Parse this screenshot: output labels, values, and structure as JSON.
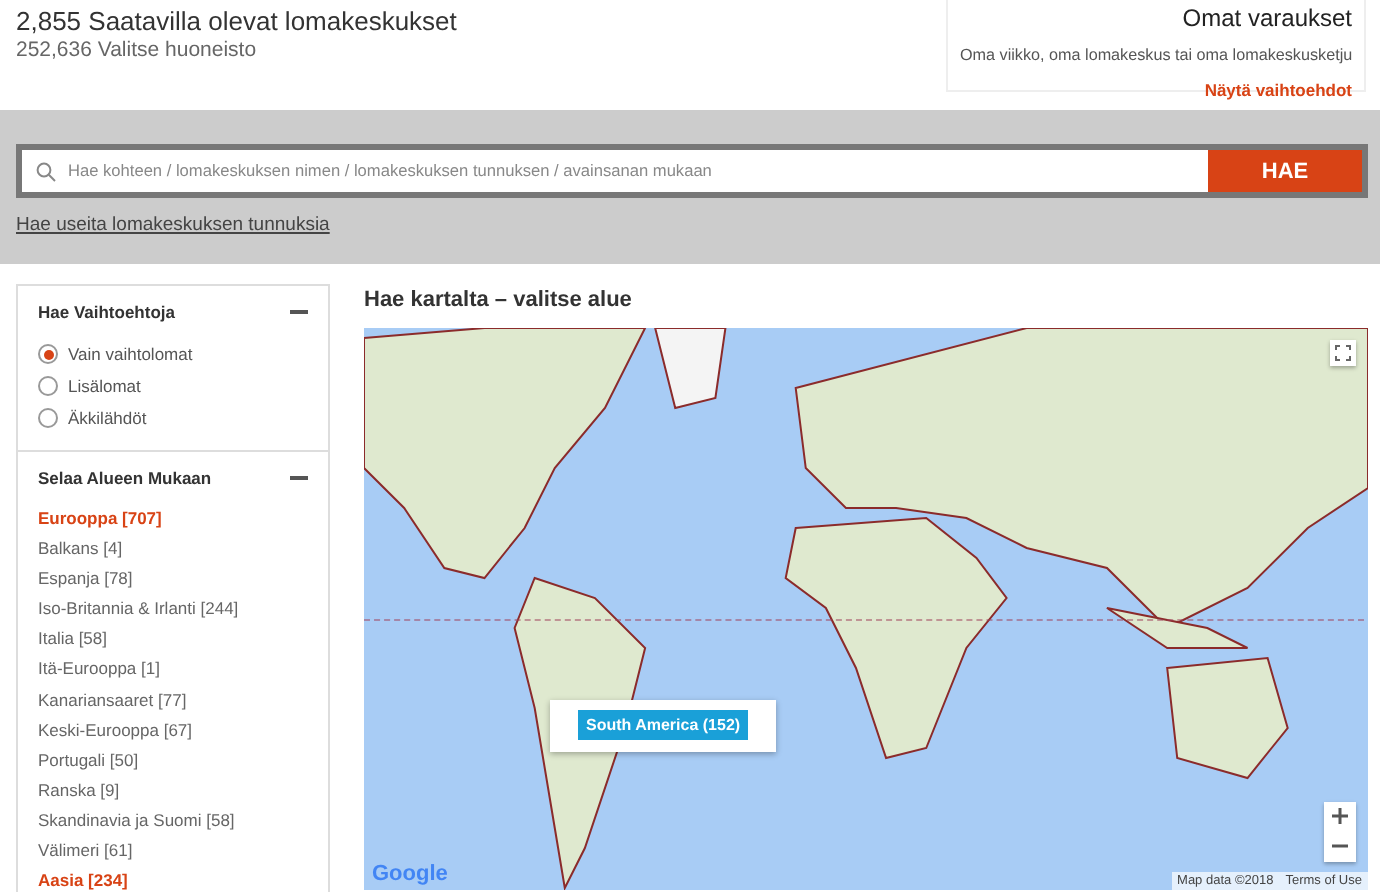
{
  "header": {
    "title": "2,855 Saatavilla olevat lomakeskukset",
    "subtitle": "252,636 Valitse huoneisto"
  },
  "bookings": {
    "title": "Omat varaukset",
    "text": "Oma viikko, oma lomakeskus tai oma lomakeskusketju",
    "link": "Näytä vaihtoehdot"
  },
  "search": {
    "placeholder": "Hae kohteen / lomakeskuksen nimen / lomakeskuksen tunnuksen / avainsanan mukaan",
    "button": "HAE",
    "link": "Hae useita lomakeskuksen tunnuksia"
  },
  "sidebar": {
    "options": {
      "title": "Hae Vaihtoehtoja",
      "expanded": true,
      "items": [
        {
          "label": "Vain vaihtolomat",
          "selected": true
        },
        {
          "label": "Lisälomat",
          "selected": false
        },
        {
          "label": "Äkkilähdöt",
          "selected": false
        }
      ]
    },
    "regions": {
      "title": "Selaa Alueen Mukaan",
      "expanded": true,
      "items": [
        {
          "label": "Eurooppa [707]",
          "kind": "region"
        },
        {
          "label": "Balkans [4]",
          "kind": "subregion"
        },
        {
          "label": "Espanja [78]",
          "kind": "subregion"
        },
        {
          "label": "Iso-Britannia & Irlanti [244]",
          "kind": "subregion"
        },
        {
          "label": "Italia [58]",
          "kind": "subregion"
        },
        {
          "label": "Itä-Eurooppa [1]",
          "kind": "subregion"
        },
        {
          "label": "Kanariansaaret [77]",
          "kind": "subregion"
        },
        {
          "label": "Keski-Eurooppa [67]",
          "kind": "subregion"
        },
        {
          "label": "Portugali [50]",
          "kind": "subregion"
        },
        {
          "label": "Ranska [9]",
          "kind": "subregion"
        },
        {
          "label": "Skandinavia ja Suomi [58]",
          "kind": "subregion"
        },
        {
          "label": "Välimeri [61]",
          "kind": "subregion"
        },
        {
          "label": "Aasia [234]",
          "kind": "region"
        }
      ]
    }
  },
  "map": {
    "title": "Hae kartalta – valitse alue",
    "tooltip": "South America (152)",
    "attribution": "Map data ©2018",
    "terms": "Terms of Use",
    "logo": "Google"
  }
}
